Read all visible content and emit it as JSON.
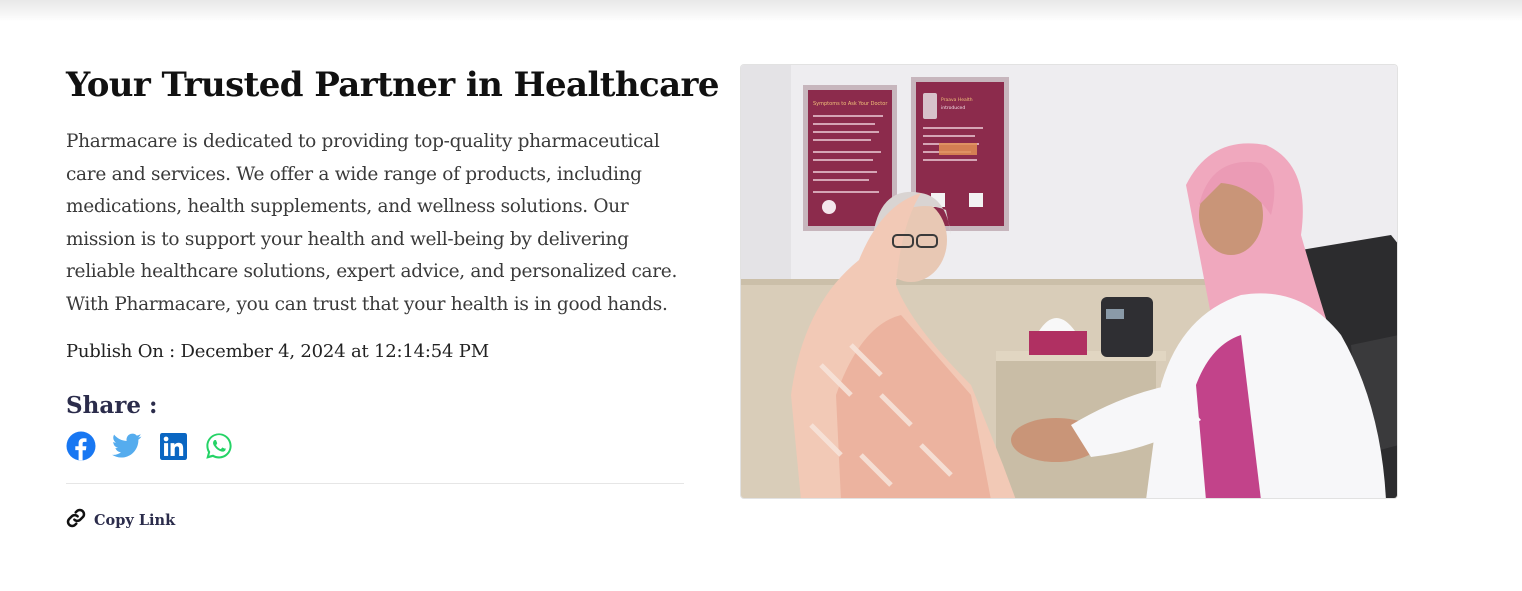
{
  "article": {
    "title": "Your Trusted Partner in Healthcare",
    "body": "Pharmacare is dedicated to providing top-quality pharmaceutical care and services. We offer a wide range of products, including medications, health supplements, and wellness solutions. Our mission is to support your health and well-being by delivering reliable healthcare solutions, expert advice, and personalized care. With Pharmacare, you can trust that your health is in good hands.",
    "publish_label": "Publish On : December 4, 2024 at 12:14:54 PM"
  },
  "share": {
    "title": "Share :",
    "icons": [
      {
        "name": "facebook-icon",
        "color": "#1877f2"
      },
      {
        "name": "twitter-icon",
        "color": "#55acee"
      },
      {
        "name": "linkedin-icon",
        "color": "#0a66c2"
      },
      {
        "name": "whatsapp-icon",
        "color": "#25d366"
      }
    ]
  },
  "copy_link": {
    "label": "Copy Link",
    "icon": "link-icon"
  },
  "photo": {
    "poster_left_heading": "Symptoms to Ask Your Doctor",
    "poster_right_heading": "Praava Health introduced Bangladesh's first Patient Portal app!",
    "poster_right_footer": "Download the app now:"
  }
}
